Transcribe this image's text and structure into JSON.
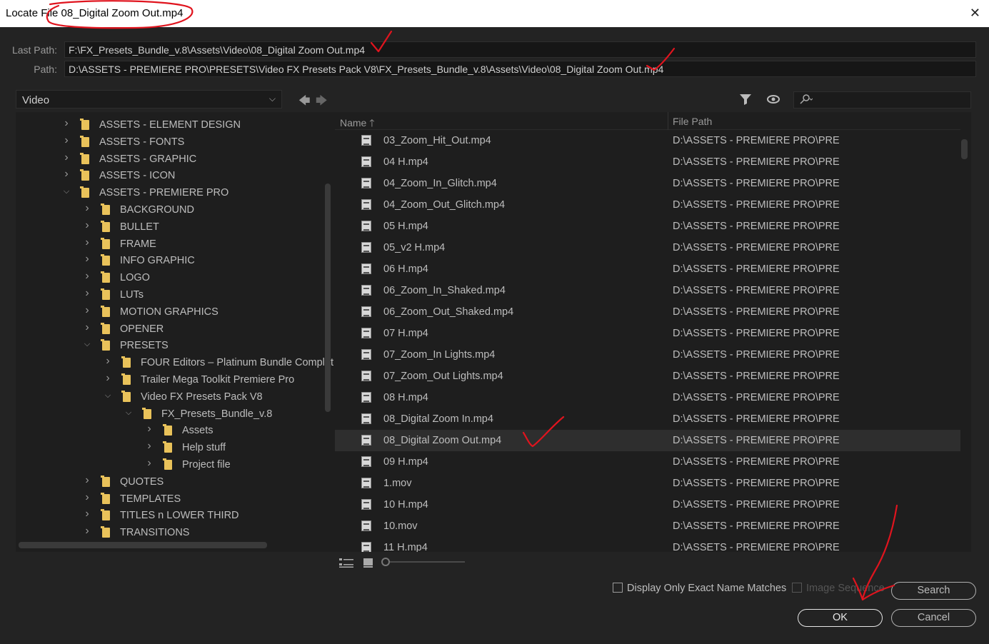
{
  "window": {
    "title": "Locate File 08_Digital Zoom Out.mp4",
    "close_icon": "close-icon"
  },
  "paths": {
    "last_path_label": "Last Path:",
    "last_path_value": "F:\\FX_Presets_Bundle_v.8\\Assets\\Video\\08_Digital Zoom Out.mp4",
    "path_label": "Path:",
    "path_value": "D:\\ASSETS - PREMIERE PRO\\PRESETS\\Video FX Presets Pack V8\\FX_Presets_Bundle_v.8\\Assets\\Video\\08_Digital Zoom Out.mp4"
  },
  "location": {
    "selected": "Video"
  },
  "tree": [
    {
      "label": "ASSETS - ELEMENT DESIGN",
      "depth": 0,
      "expanded": false
    },
    {
      "label": "ASSETS - FONTS",
      "depth": 0,
      "expanded": false
    },
    {
      "label": "ASSETS - GRAPHIC",
      "depth": 0,
      "expanded": false
    },
    {
      "label": "ASSETS - ICON",
      "depth": 0,
      "expanded": false
    },
    {
      "label": "ASSETS - PREMIERE PRO",
      "depth": 0,
      "expanded": true
    },
    {
      "label": "BACKGROUND",
      "depth": 1,
      "expanded": false
    },
    {
      "label": "BULLET",
      "depth": 1,
      "expanded": false
    },
    {
      "label": "FRAME",
      "depth": 1,
      "expanded": false
    },
    {
      "label": "INFO GRAPHIC",
      "depth": 1,
      "expanded": false
    },
    {
      "label": "LOGO",
      "depth": 1,
      "expanded": false
    },
    {
      "label": "LUTs",
      "depth": 1,
      "expanded": false
    },
    {
      "label": "MOTION GRAPHICS",
      "depth": 1,
      "expanded": false
    },
    {
      "label": "OPENER",
      "depth": 1,
      "expanded": false
    },
    {
      "label": "PRESETS",
      "depth": 1,
      "expanded": true
    },
    {
      "label": "FOUR Editors – Platinum Bundle Complet",
      "depth": 2,
      "expanded": false
    },
    {
      "label": "Trailer Mega Toolkit Premiere Pro",
      "depth": 2,
      "expanded": false
    },
    {
      "label": "Video FX Presets Pack V8",
      "depth": 2,
      "expanded": true
    },
    {
      "label": "FX_Presets_Bundle_v.8",
      "depth": 3,
      "expanded": true
    },
    {
      "label": "Assets",
      "depth": 4,
      "expanded": false
    },
    {
      "label": "Help stuff",
      "depth": 4,
      "expanded": false
    },
    {
      "label": "Project file",
      "depth": 4,
      "expanded": false
    },
    {
      "label": "QUOTES",
      "depth": 1,
      "expanded": false
    },
    {
      "label": "TEMPLATES",
      "depth": 1,
      "expanded": false
    },
    {
      "label": "TITLES n LOWER THIRD",
      "depth": 1,
      "expanded": false
    },
    {
      "label": "TRANSITIONS",
      "depth": 1,
      "expanded": false
    }
  ],
  "list": {
    "col_name": "Name",
    "col_path": "File Path",
    "rows": [
      {
        "name": "03_Zoom_Hit_Out.mp4",
        "path": "D:\\ASSETS - PREMIERE PRO\\PRE"
      },
      {
        "name": "04 H.mp4",
        "path": "D:\\ASSETS - PREMIERE PRO\\PRE"
      },
      {
        "name": "04_Zoom_In_Glitch.mp4",
        "path": "D:\\ASSETS - PREMIERE PRO\\PRE"
      },
      {
        "name": "04_Zoom_Out_Glitch.mp4",
        "path": "D:\\ASSETS - PREMIERE PRO\\PRE"
      },
      {
        "name": "05 H.mp4",
        "path": "D:\\ASSETS - PREMIERE PRO\\PRE"
      },
      {
        "name": "05_v2 H.mp4",
        "path": "D:\\ASSETS - PREMIERE PRO\\PRE"
      },
      {
        "name": "06 H.mp4",
        "path": "D:\\ASSETS - PREMIERE PRO\\PRE"
      },
      {
        "name": "06_Zoom_In_Shaked.mp4",
        "path": "D:\\ASSETS - PREMIERE PRO\\PRE"
      },
      {
        "name": "06_Zoom_Out_Shaked.mp4",
        "path": "D:\\ASSETS - PREMIERE PRO\\PRE"
      },
      {
        "name": "07 H.mp4",
        "path": "D:\\ASSETS - PREMIERE PRO\\PRE"
      },
      {
        "name": "07_Zoom_In Lights.mp4",
        "path": "D:\\ASSETS - PREMIERE PRO\\PRE"
      },
      {
        "name": "07_Zoom_Out Lights.mp4",
        "path": "D:\\ASSETS - PREMIERE PRO\\PRE"
      },
      {
        "name": "08 H.mp4",
        "path": "D:\\ASSETS - PREMIERE PRO\\PRE"
      },
      {
        "name": "08_Digital Zoom In.mp4",
        "path": "D:\\ASSETS - PREMIERE PRO\\PRE"
      },
      {
        "name": "08_Digital Zoom Out.mp4",
        "path": "D:\\ASSETS - PREMIERE PRO\\PRE",
        "selected": true
      },
      {
        "name": "09 H.mp4",
        "path": "D:\\ASSETS - PREMIERE PRO\\PRE"
      },
      {
        "name": "1.mov",
        "path": "D:\\ASSETS - PREMIERE PRO\\PRE"
      },
      {
        "name": "10 H.mp4",
        "path": "D:\\ASSETS - PREMIERE PRO\\PRE"
      },
      {
        "name": "10.mov",
        "path": "D:\\ASSETS - PREMIERE PRO\\PRE"
      },
      {
        "name": "11 H.mp4",
        "path": "D:\\ASSETS - PREMIERE PRO\\PRE"
      }
    ]
  },
  "options": {
    "exact_match_label": "Display Only Exact Name Matches",
    "image_sequence_label": "Image Sequence"
  },
  "buttons": {
    "search": "Search",
    "ok": "OK",
    "cancel": "Cancel"
  },
  "colors": {
    "annotation": "#e0141e",
    "folder": "#e9c25a",
    "background": "#232323"
  }
}
